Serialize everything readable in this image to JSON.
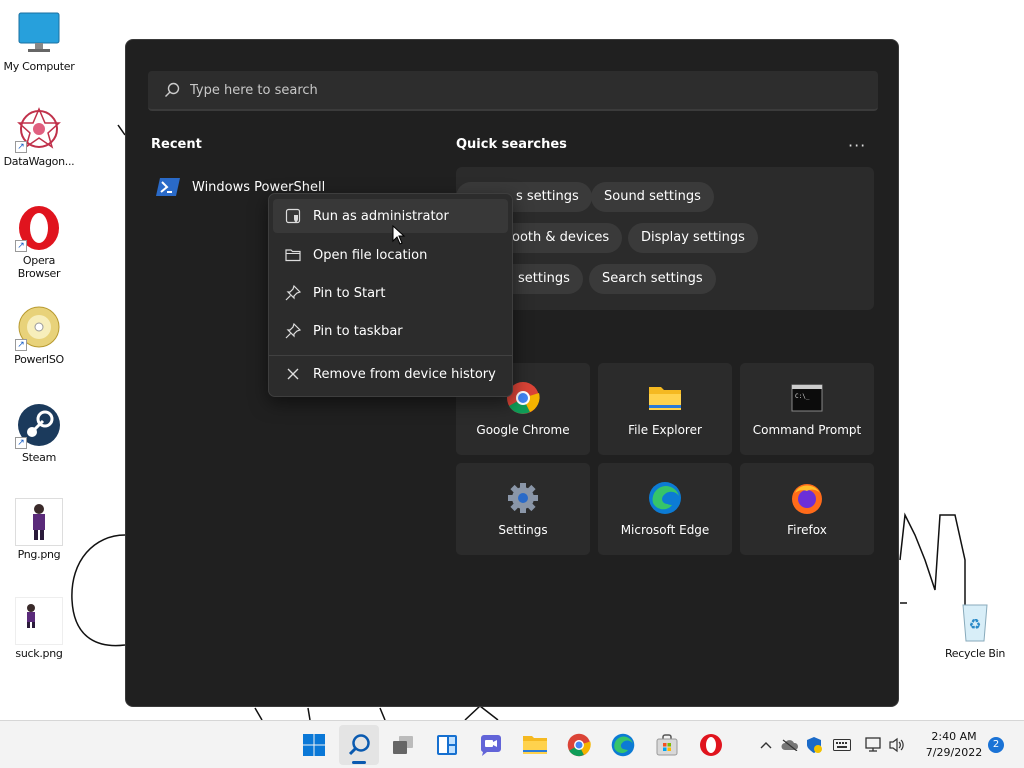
{
  "desktop": {
    "icons": [
      {
        "label": "My Computer",
        "icon": "monitor-icon"
      },
      {
        "label": "DataWagon...",
        "icon": "datawagon-icon"
      },
      {
        "label": "Opera\nBrowser",
        "icon": "opera-icon"
      },
      {
        "label": "PowerISO",
        "icon": "poweriso-icon"
      },
      {
        "label": "Steam",
        "icon": "steam-icon"
      },
      {
        "label": "Png.png",
        "icon": "image-icon"
      },
      {
        "label": "suck.png",
        "icon": "image-icon"
      },
      {
        "label": "Recycle Bin",
        "icon": "recycle-bin-icon"
      }
    ]
  },
  "search": {
    "placeholder": "Type here to search"
  },
  "recent": {
    "title": "Recent",
    "items": [
      {
        "label": "Windows PowerShell",
        "icon": "powershell-icon"
      }
    ]
  },
  "quick_searches": {
    "title": "Quick searches",
    "more": "···",
    "chips": [
      "s settings",
      "Sound settings",
      "ooth & devices",
      "Display settings",
      "settings",
      "Search settings"
    ]
  },
  "top_apps": [
    {
      "label": "Google Chrome",
      "icon": "chrome-icon"
    },
    {
      "label": "File Explorer",
      "icon": "folder-icon"
    },
    {
      "label": "Command Prompt",
      "icon": "cmd-icon"
    },
    {
      "label": "Settings",
      "icon": "gear-icon"
    },
    {
      "label": "Microsoft Edge",
      "icon": "edge-icon"
    },
    {
      "label": "Firefox",
      "icon": "firefox-icon"
    }
  ],
  "context_menu": {
    "items": [
      {
        "label": "Run as administrator",
        "icon": "shield-icon"
      },
      {
        "label": "Open file location",
        "icon": "folder-outline-icon"
      },
      {
        "label": "Pin to Start",
        "icon": "pin-icon"
      },
      {
        "label": "Pin to taskbar",
        "icon": "pin-icon"
      },
      {
        "label": "Remove from device history",
        "icon": "close-icon"
      }
    ]
  },
  "taskbar": {
    "apps": [
      "windows-start-icon",
      "search-icon",
      "task-view-icon",
      "widgets-icon",
      "chat-icon",
      "file-explorer-icon",
      "chrome-icon",
      "edge-icon",
      "store-icon",
      "opera-icon"
    ],
    "time": "2:40 AM",
    "date": "7/29/2022",
    "notifications": "2"
  },
  "colors": {
    "flyout_bg": "#202020",
    "panel_bg": "#2b2b2b",
    "chip_bg": "#3a3a3a",
    "accent": "#1a73d6"
  }
}
